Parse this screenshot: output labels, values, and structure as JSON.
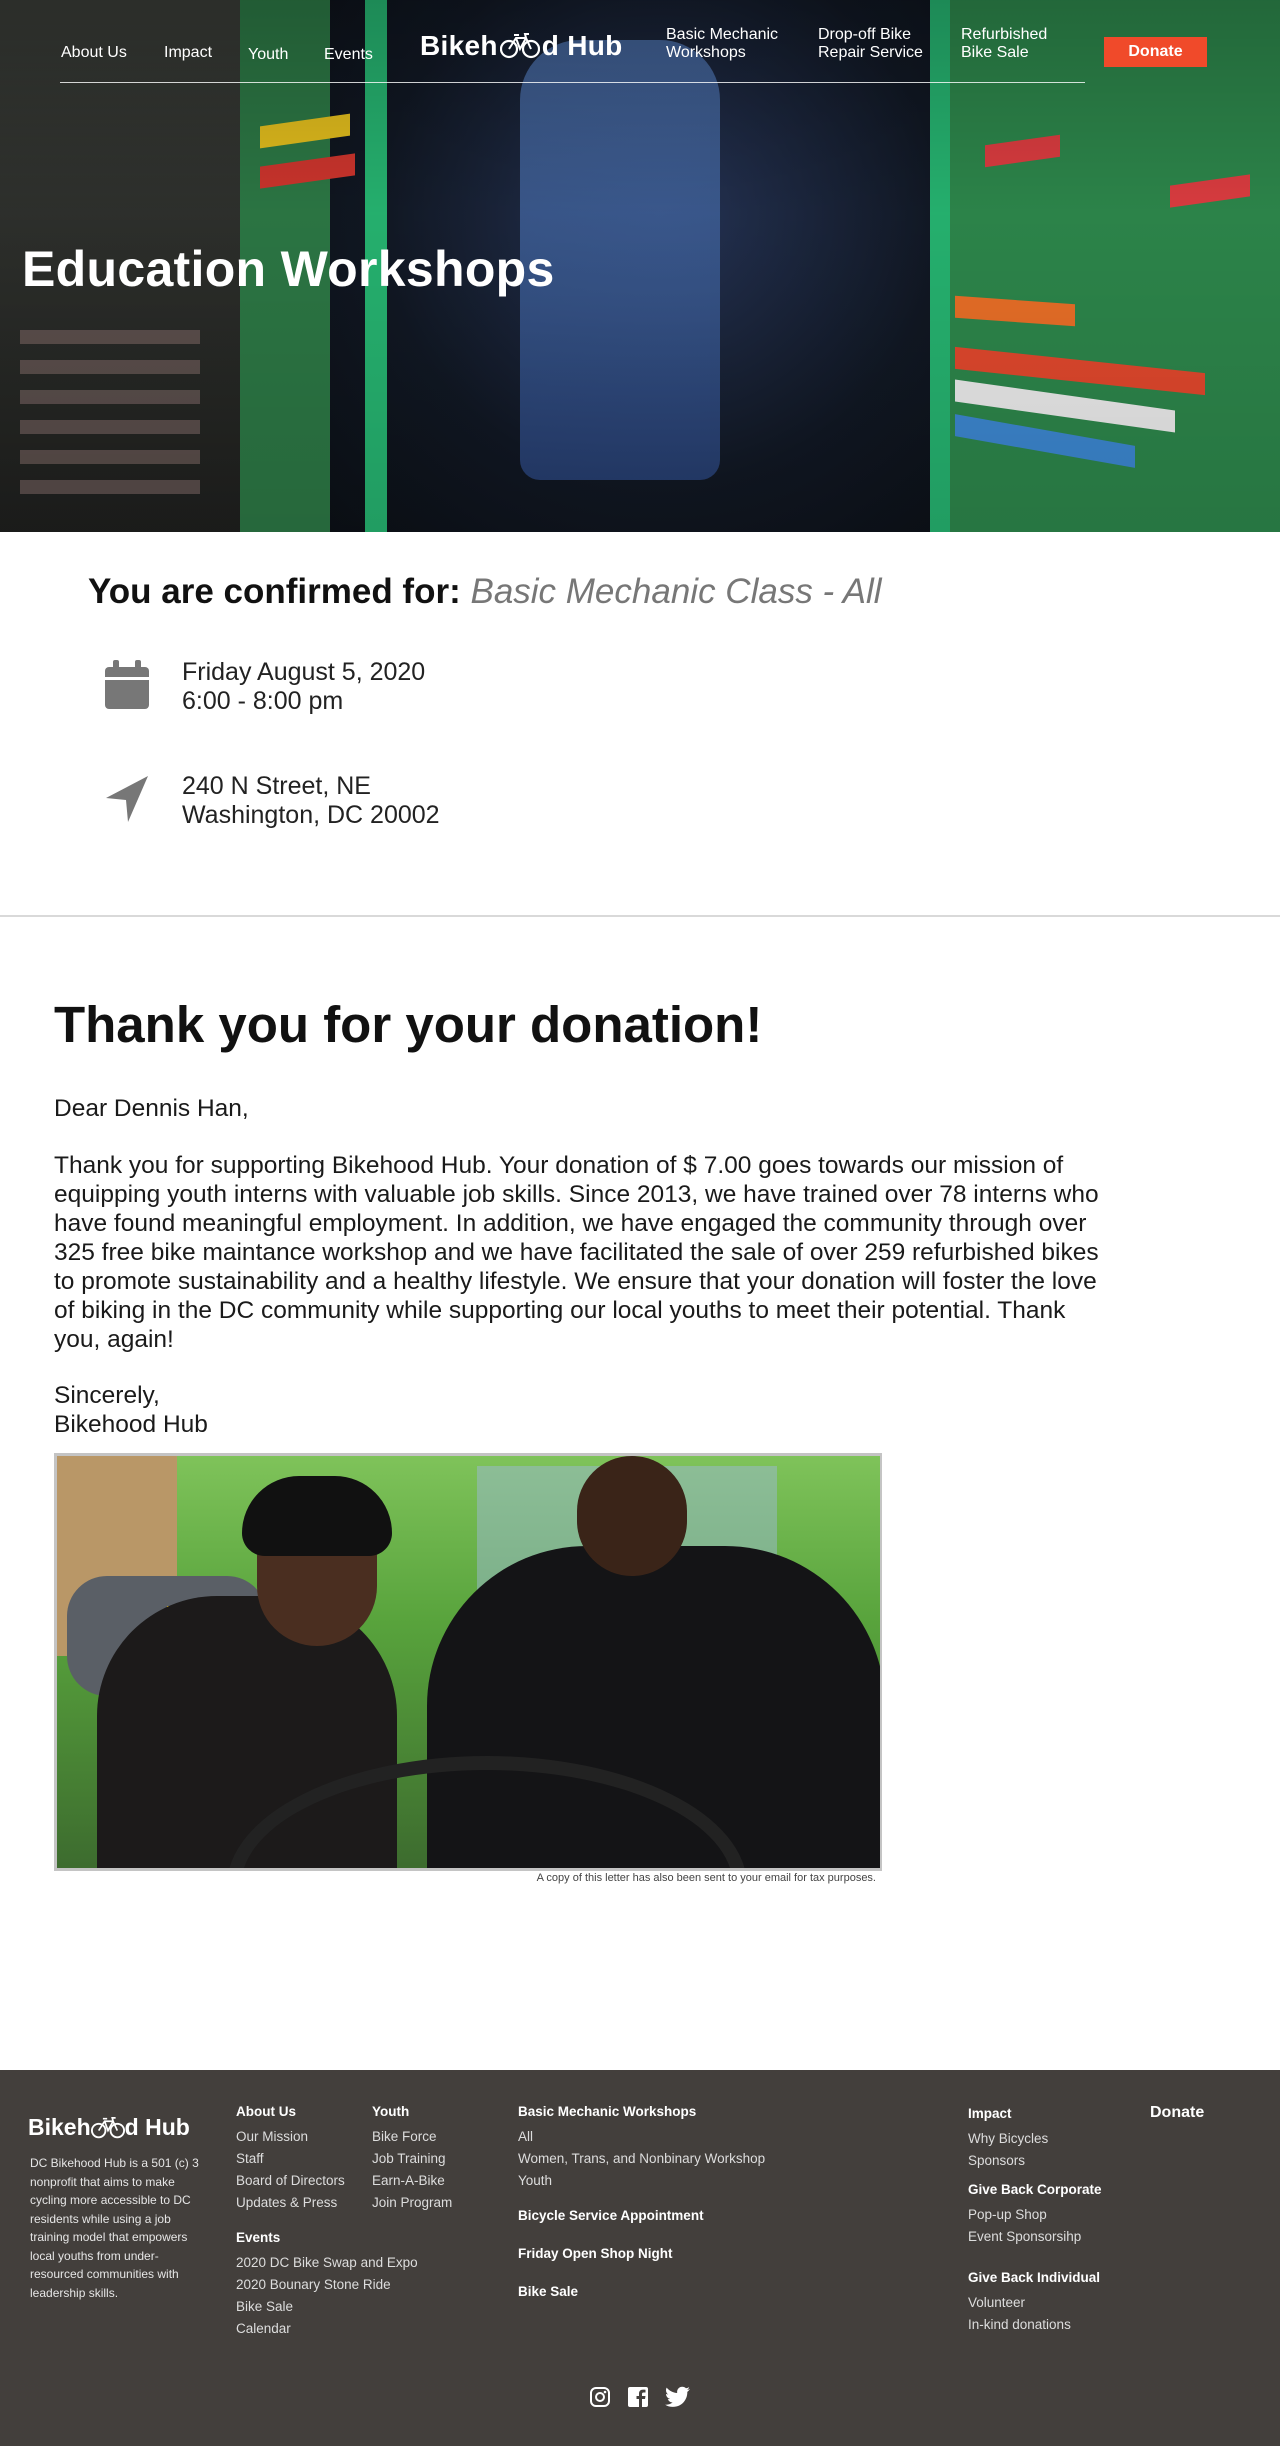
{
  "nav": {
    "left": [
      "About Us",
      "Impact",
      "Youth",
      "Events"
    ],
    "logo": "Bikehood Hub",
    "right": [
      {
        "line1": "Basic Mechanic",
        "line2": "Workshops"
      },
      {
        "line1": "Drop-off Bike",
        "line2": "Repair Service"
      },
      {
        "line1": "Refurbished",
        "line2": "Bike Sale"
      }
    ],
    "donate": "Donate"
  },
  "hero": {
    "title": "Education Workshops"
  },
  "confirmation": {
    "label": "You are confirmed for:",
    "event": "Basic Mechanic Class - All",
    "date": "Friday August 5, 2020",
    "time": "6:00 - 8:00 pm",
    "address_line1": "240 N Street, NE",
    "address_line2": "Washington, DC 20002",
    "icons": [
      "calendar-icon",
      "location-arrow-icon"
    ]
  },
  "letter": {
    "heading": "Thank you for your donation!",
    "greeting": "Dear Dennis Han,",
    "body": "Thank you for supporting Bikehood Hub. Your donation of $ 7.00 goes towards our mission of equipping youth interns with valuable job skills. Since 2013, we have trained over 78 interns who have found meaningful employment. In addition, we have engaged the community through over 325 free bike maintance workshop and we have facilitated the sale of over 259 refurbished bikes to promote sustainability and a healthy lifestyle. We ensure that your donation will foster the love of biking in the DC community while supporting our local youths to meet their potential. Thank you, again!",
    "closing": "Sincerely,",
    "signature": "Bikehood Hub",
    "photo_note": "A copy of this letter has also been sent to your email for tax purposes."
  },
  "footer": {
    "logo": "Bikehood Hub",
    "description": "DC Bikehood Hub is a 501 (c) 3 nonprofit that aims to make cycling more accessible to DC residents while using a job training model that empowers local youths from under-resourced communities with leadership skills.",
    "about": {
      "title": "About Us",
      "links": [
        "Our Mission",
        "Staff",
        "Board of Directors",
        "Updates & Press"
      ]
    },
    "youth": {
      "title": "Youth",
      "links": [
        "Bike Force",
        "Job Training",
        "Earn-A-Bike",
        "Join Program"
      ]
    },
    "events": {
      "title": "Events",
      "links": [
        "2020 DC Bike Swap and Expo",
        "2020 Bounary Stone Ride",
        "Bike Sale",
        "Calendar"
      ]
    },
    "workshops": {
      "title": "Basic Mechanic Workshops",
      "links": [
        "All",
        "Women, Trans, and Nonbinary Workshop",
        "Youth"
      ]
    },
    "service": "Bicycle Service Appointment",
    "open_shop": "Friday Open Shop Night",
    "bike_sale": "Bike Sale",
    "impact": {
      "title": "Impact",
      "links": [
        "Why Bicycles",
        "Sponsors"
      ]
    },
    "corporate": {
      "title": "Give Back Corporate",
      "links": [
        "Pop-up Shop",
        "Event Sponsorsihp"
      ]
    },
    "individual": {
      "title": "Give Back Individual",
      "links": [
        "Volunteer",
        "In-kind donations"
      ]
    },
    "donate": "Donate",
    "social_icons": [
      "instagram-icon",
      "facebook-icon",
      "twitter-icon"
    ]
  },
  "colors": {
    "accent": "#f04a2a",
    "footer_bg": "#433f3c",
    "event_gray": "#777777"
  }
}
